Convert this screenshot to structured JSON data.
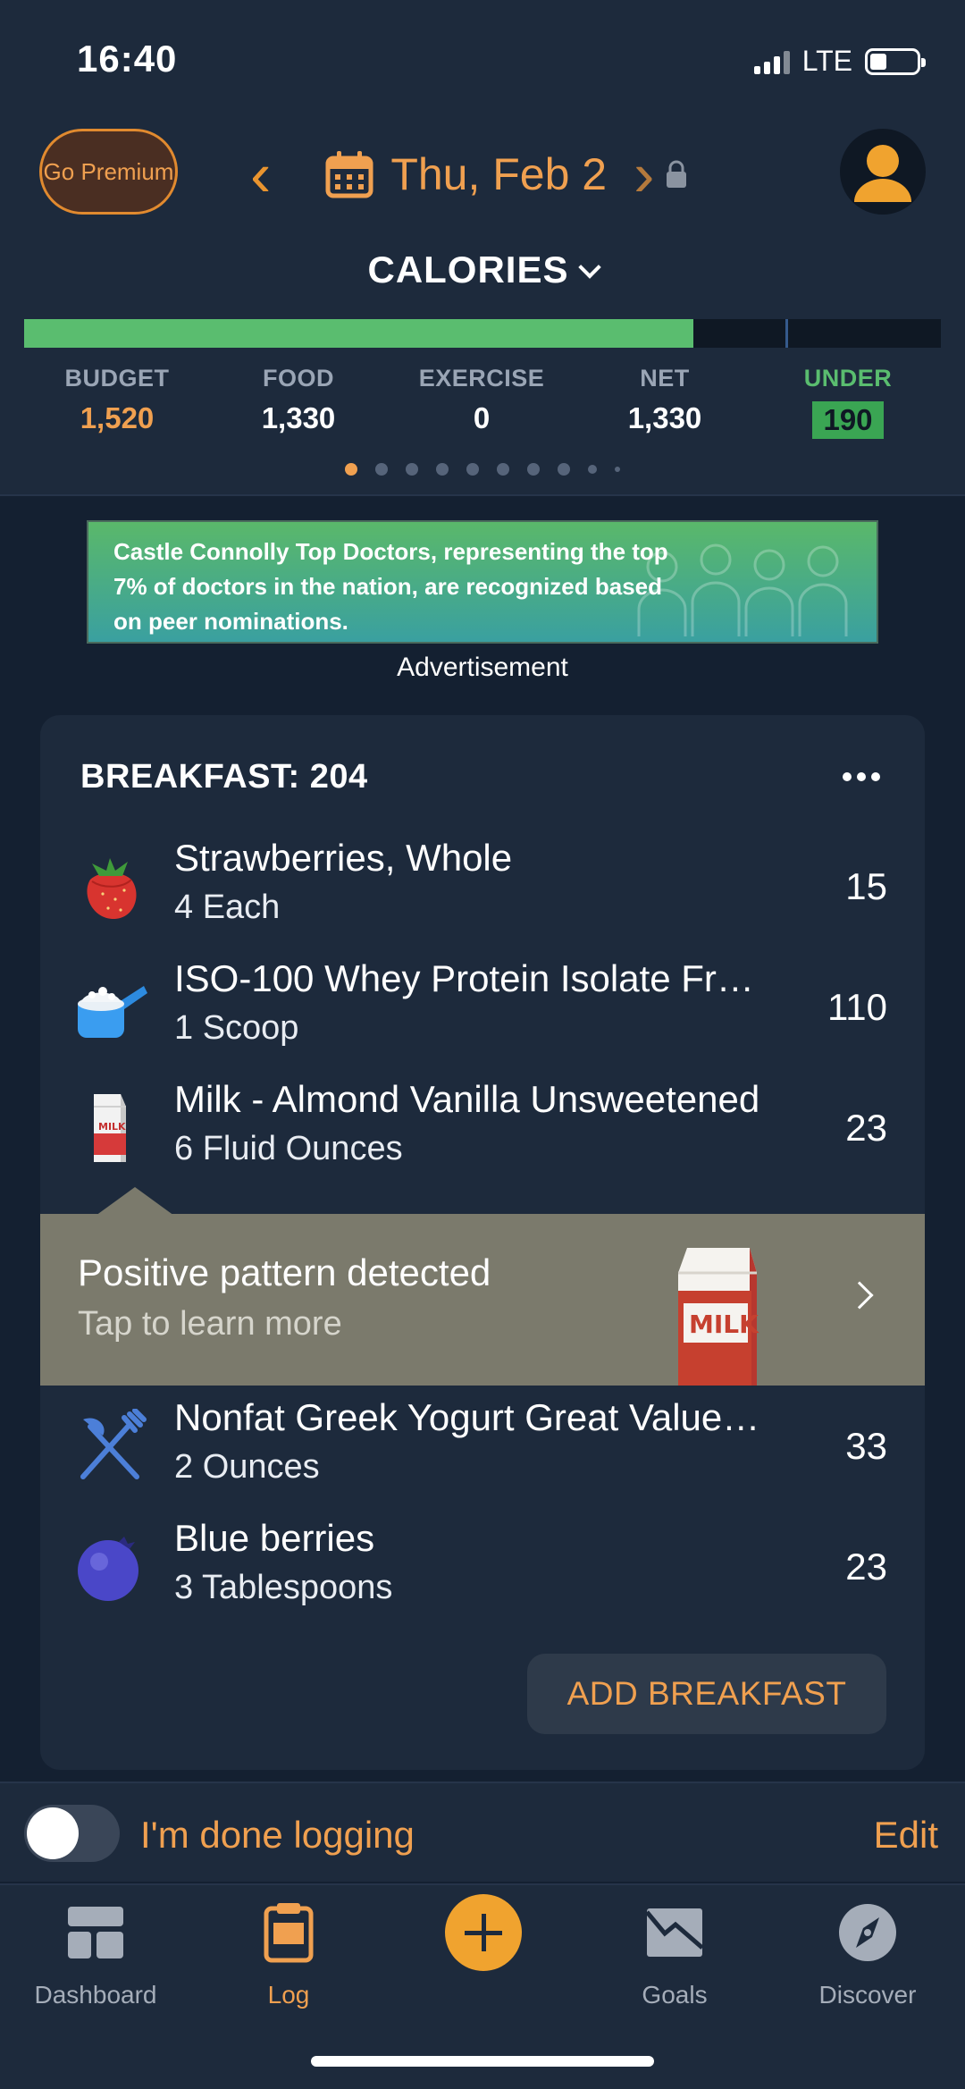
{
  "status": {
    "time": "16:40",
    "network": "LTE"
  },
  "header": {
    "premium_label": "Go Premium",
    "date": "Thu, Feb 2",
    "section_title": "CALORIES",
    "progress_fraction": 0.73,
    "marker_fraction": 0.83,
    "stats": [
      {
        "label": "BUDGET",
        "value": "1,520"
      },
      {
        "label": "FOOD",
        "value": "1,330"
      },
      {
        "label": "EXERCISE",
        "value": "0"
      },
      {
        "label": "NET",
        "value": "1,330"
      },
      {
        "label": "UNDER",
        "value": "190"
      }
    ],
    "page_count": 10,
    "active_page": 1
  },
  "ad": {
    "text": "Castle Connolly Top Doctors, representing the top 7% of doctors in the nation, are recognized based on peer nominations.",
    "label": "Advertisement"
  },
  "meal": {
    "title": "BREAKFAST: 204",
    "items": [
      {
        "name": "Strawberries, Whole",
        "qty": "4 Each",
        "cal": "15",
        "icon": "strawberry-icon"
      },
      {
        "name": "ISO-100 Whey Protein Isolate Fr…",
        "qty": "1 Scoop",
        "cal": "110",
        "icon": "protein-scoop-icon"
      },
      {
        "name": "Milk - Almond Vanilla Unsweetened",
        "qty": "6 Fluid Ounces",
        "cal": "23",
        "icon": "milk-carton-icon"
      },
      {
        "name": "Nonfat Greek Yogurt Great Value…",
        "qty": "2 Ounces",
        "cal": "33",
        "icon": "fork-knife-icon"
      },
      {
        "name": "Blue berries",
        "qty": "3 Tablespoons",
        "cal": "23",
        "icon": "blueberry-icon"
      }
    ],
    "pattern": {
      "title": "Positive pattern detected",
      "subtitle": "Tap to learn more",
      "milk_text": "MILK",
      "carton_text": "MILK"
    },
    "add_label": "ADD BREAKFAST"
  },
  "done": {
    "label": "I'm done logging",
    "edit": "Edit",
    "toggle_on": false
  },
  "tabs": [
    {
      "label": "Dashboard",
      "icon": "dashboard-icon"
    },
    {
      "label": "Log",
      "icon": "clipboard-icon"
    },
    {
      "label": "",
      "icon": "plus-icon"
    },
    {
      "label": "Goals",
      "icon": "goals-icon"
    },
    {
      "label": "Discover",
      "icon": "compass-icon"
    }
  ],
  "colors": {
    "accent": "#f0a050",
    "green": "#5abd6f",
    "background": "#142031",
    "panel": "#1d2a3c"
  }
}
